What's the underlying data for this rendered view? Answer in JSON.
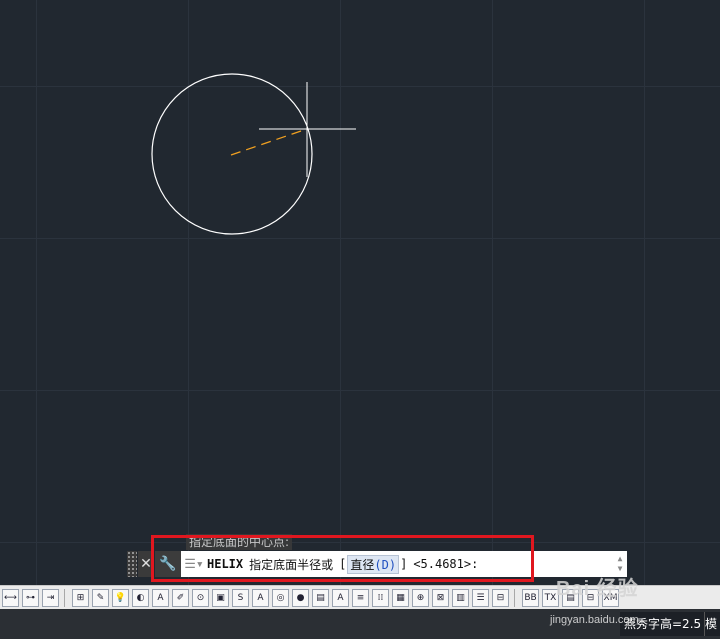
{
  "command_line": {
    "history_prompt": "指定底面的中心点:",
    "close_symbol": "✕",
    "tools_icon": "wrench-icon",
    "menu_icon": "command-menu-icon",
    "command_name": "HELIX",
    "prompt_text": "指定底面半径或",
    "option_bracket_open": "[",
    "option_label": "直径",
    "option_key": "(D)",
    "option_bracket_close": "]",
    "default_value": "<5.4681>:"
  },
  "toolbar": {
    "buttons": [
      "⟷",
      "⊶",
      "⇥",
      "⊞",
      "✎",
      "💡",
      "◐",
      "A",
      "✐",
      "⊙",
      "▣",
      "S",
      "A",
      "◎",
      "●",
      "▤",
      "A",
      "≡",
      "⁞⁞",
      "▦",
      "⊕",
      "⊠",
      "▥",
      "☰",
      "⊟",
      "BB",
      "TX",
      "▤",
      "⊟",
      "XM"
    ]
  },
  "statusbar": {
    "text_height": "燕秀字高=2.5",
    "model_label": "模"
  },
  "watermark": {
    "logo": "Bai 经验",
    "url": "jingyan.baidu.com"
  },
  "colors": {
    "canvas_bg": "#212830",
    "circle": "#ffffff",
    "rubber_band": "#f0a020",
    "highlight": "#e0171f"
  }
}
